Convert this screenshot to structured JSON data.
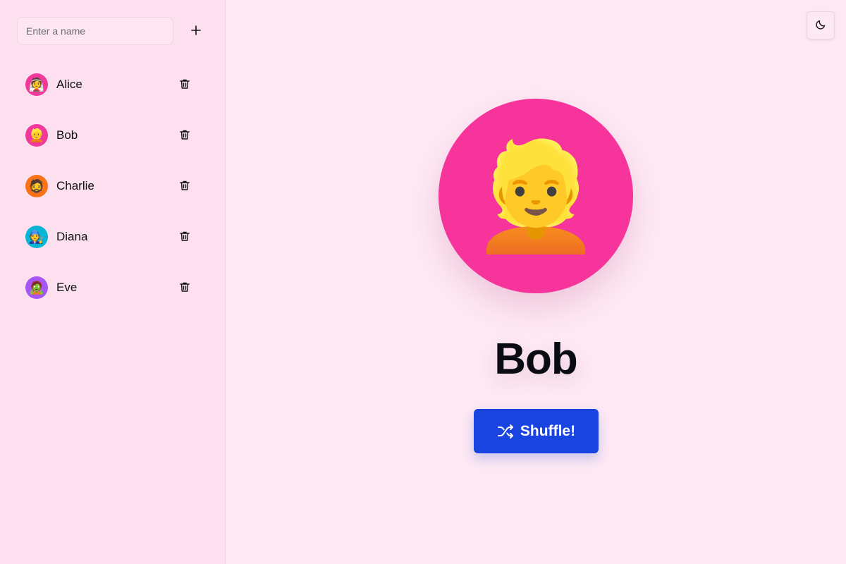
{
  "sidebar": {
    "name_input": {
      "value": "",
      "placeholder": "Enter a name"
    },
    "add_icon": "plus-icon",
    "people": [
      {
        "name": "Alice",
        "emoji": "👰",
        "color": "#f0399a"
      },
      {
        "name": "Bob",
        "emoji": "👱",
        "color": "#f0399a"
      },
      {
        "name": "Charlie",
        "emoji": "🧔",
        "color": "#f97316"
      },
      {
        "name": "Diana",
        "emoji": "🧑‍🔧",
        "color": "#06b6d4"
      },
      {
        "name": "Eve",
        "emoji": "🧟",
        "color": "#a855f7"
      }
    ],
    "delete_icon": "trash-icon"
  },
  "header": {
    "theme_toggle_icon": "moon-icon"
  },
  "main": {
    "selected": {
      "name": "Bob",
      "emoji": "👱",
      "color": "#f7339c"
    },
    "shuffle_button": {
      "label": "Shuffle!",
      "icon": "shuffle-icon",
      "color": "#1a44e0"
    }
  }
}
